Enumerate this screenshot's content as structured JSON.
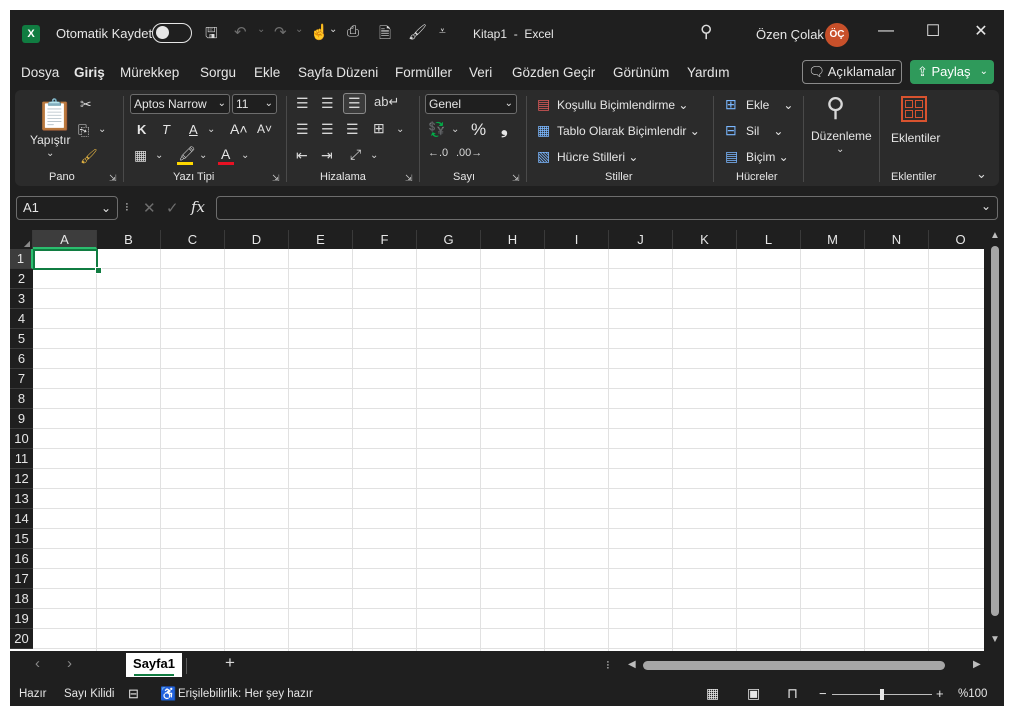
{
  "titlebar": {
    "app_icon": "X",
    "autosave_label": "Otomatik Kaydet",
    "doc_title": "Kitap1  -  Excel",
    "user_name": "Özen Çolak",
    "user_initials": "ÖÇ"
  },
  "menu": {
    "items": [
      "Dosya",
      "Giriş",
      "Mürekkep",
      "Sorgu",
      "Ekle",
      "Sayfa Düzeni",
      "Formüller",
      "Veri",
      "Gözden Geçir",
      "Görünüm",
      "Yardım"
    ],
    "active": "Giriş",
    "comments_label": "Açıklamalar",
    "share_label": "Paylaş"
  },
  "ribbon": {
    "pano": {
      "label": "Pano",
      "paste_label": "Yapıştır"
    },
    "font": {
      "label": "Yazı Tipi",
      "font_name": "Aptos Narrow",
      "font_size": "11",
      "bold": "K",
      "italic": "T",
      "underline": "A",
      "grow": "A˄",
      "shrink": "A˅",
      "font_color": "A"
    },
    "alignment": {
      "label": "Hizalama"
    },
    "number": {
      "label": "Sayı",
      "format": "Genel",
      "percent": "%",
      "comma": "❟"
    },
    "styles": {
      "label": "Stiller",
      "conditional": "Koşullu Biçimlendirme",
      "table": "Tablo Olarak Biçimlendir",
      "cell_styles": "Hücre Stilleri"
    },
    "cells": {
      "label": "Hücreler",
      "insert": "Ekle",
      "delete": "Sil",
      "format": "Biçim"
    },
    "editing": {
      "label": "Düzenleme"
    },
    "addins": {
      "label": "Eklentiler",
      "button": "Eklentiler"
    }
  },
  "formula_bar": {
    "name_box": "A1",
    "fx": "fx",
    "content": ""
  },
  "grid": {
    "columns": [
      "A",
      "B",
      "C",
      "D",
      "E",
      "F",
      "G",
      "H",
      "I",
      "J",
      "K",
      "L",
      "M",
      "N",
      "O"
    ],
    "rows": [
      "1",
      "2",
      "3",
      "4",
      "5",
      "6",
      "7",
      "8",
      "9",
      "10",
      "11",
      "12",
      "13",
      "14",
      "15",
      "16",
      "17",
      "18",
      "19",
      "20"
    ],
    "selected_cell": "A1"
  },
  "sheets": {
    "tabs": [
      "Sayfa1"
    ],
    "active": "Sayfa1"
  },
  "statusbar": {
    "ready": "Hazır",
    "numlock": "Sayı Kilidi",
    "accessibility": "Erişilebilirlik: Her şey hazır",
    "zoom_minus": "−",
    "zoom_plus": "+",
    "zoom": "%100",
    "zoom_level_percent": 100
  },
  "colors": {
    "accent": "#107c41",
    "share": "#2f9a5b",
    "avatar": "#c8502a",
    "background": "#1f1f1f"
  }
}
